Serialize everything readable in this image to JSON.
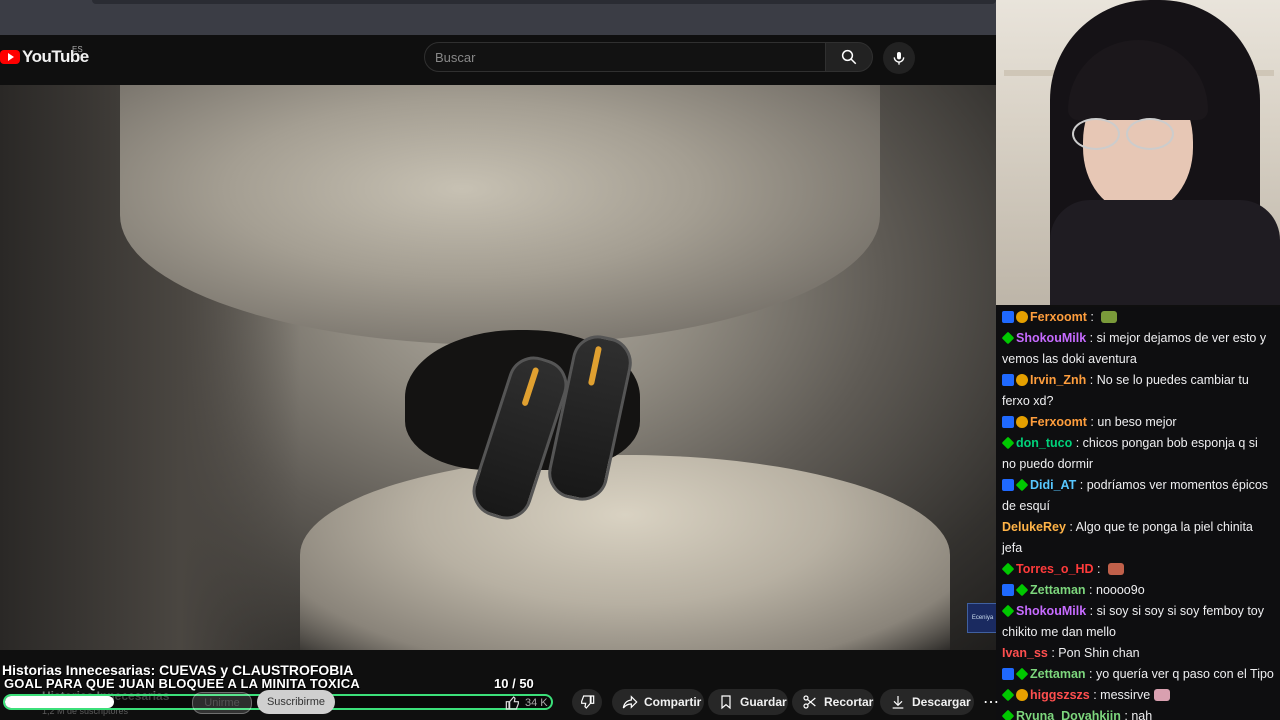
{
  "youtube": {
    "logo_text": "YouTube",
    "region": "ES",
    "search_placeholder": "Buscar",
    "video_watermark": "Eceniya"
  },
  "overlay": {
    "title": "Historias Innecesarias: CUEVAS y CLAUSTROFOBIA",
    "goal_text": "GOAL PARA QUE JUAN BLOQUEE A LA MINITA TOXICA",
    "goal_current": "10",
    "goal_total": "/ 50",
    "goal_progress": 0.2
  },
  "video_info": {
    "channel": "Historias Innecesarias",
    "subscribers": "1,2 M de suscriptores",
    "join_label": "Unirme",
    "subscribe_label": "Suscribirme",
    "likes": "34 K"
  },
  "actions": {
    "share": "Compartir",
    "save": "Guardar",
    "clip": "Recortar",
    "download": "Descargar"
  },
  "chat": [
    {
      "badges": [
        "blue",
        "gold"
      ],
      "user": "Ferxoomt",
      "color": "#ff9e3d",
      "text": "",
      "emote": "#7a9a3a"
    },
    {
      "badges": [
        "green"
      ],
      "user": "ShokouMilk",
      "color": "#c66bff",
      "text": "si mejor dejamos de ver esto y vemos las doki aventura"
    },
    {
      "badges": [
        "blue",
        "gold"
      ],
      "user": "Irvin_Znh",
      "color": "#ff9e3d",
      "text": "No se lo puedes cambiar tu ferxo xd?"
    },
    {
      "badges": [
        "blue",
        "gold"
      ],
      "user": "Ferxoomt",
      "color": "#ff9e3d",
      "text": "un beso mejor"
    },
    {
      "badges": [
        "green"
      ],
      "user": "don_tuco",
      "color": "#00d27a",
      "text": "chicos pongan bob esponja q si no puedo dormir"
    },
    {
      "badges": [
        "blue",
        "green"
      ],
      "user": "Didi_AT",
      "color": "#57c7ff",
      "text": "podríamos ver momentos épicos de esquí"
    },
    {
      "badges": [],
      "user": "DelukeRey",
      "color": "#ffb347",
      "text": "Algo que te ponga la piel chinita jefa"
    },
    {
      "badges": [
        "green"
      ],
      "user": "Torres_o_HD",
      "color": "#ff3b3b",
      "text": "",
      "emote": "#c0604a"
    },
    {
      "badges": [
        "blue",
        "green"
      ],
      "user": "Zettaman",
      "color": "#7dd67d",
      "text": "noooo9o"
    },
    {
      "badges": [
        "green"
      ],
      "user": "ShokouMilk",
      "color": "#c66bff",
      "text": "si soy si soy si soy femboy toy chikito me dan mello"
    },
    {
      "badges": [],
      "user": "Ivan_ss",
      "color": "#ff4f4f",
      "text": "Pon Shin chan"
    },
    {
      "badges": [
        "blue",
        "green"
      ],
      "user": "Zettaman",
      "color": "#7dd67d",
      "text": "yo quería ver q paso con el Tipo"
    },
    {
      "badges": [
        "green",
        "gold"
      ],
      "user": "higgszszs",
      "color": "#ff4f4f",
      "text": "messirve",
      "emote": "#d9a0b0"
    },
    {
      "badges": [
        "green"
      ],
      "user": "Ryuna_Dovahkiin",
      "color": "#7dd67d",
      "text": "nah"
    }
  ]
}
